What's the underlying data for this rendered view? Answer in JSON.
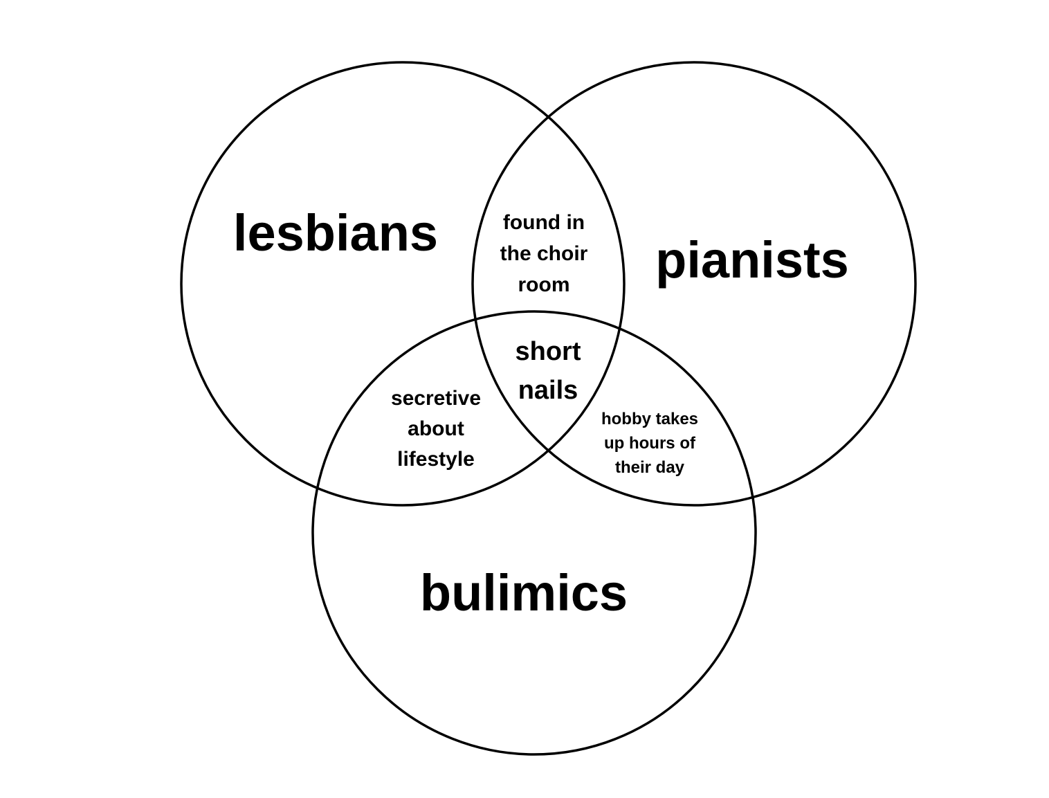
{
  "sets": [
    {
      "id": "left",
      "label": "lesbians"
    },
    {
      "id": "right",
      "label": "pianists"
    },
    {
      "id": "bottom",
      "label": "bulimics"
    }
  ],
  "intersections": {
    "left_right": [
      "found in",
      "the choir",
      "room"
    ],
    "left_bottom": [
      "secretive",
      "about",
      "lifestyle"
    ],
    "right_bottom": [
      "hobby takes",
      "up hours of",
      "their day"
    ],
    "all_three": [
      "short",
      "nails"
    ]
  },
  "colors": {
    "background": "#ffffff",
    "stroke": "#000000",
    "text": "#000000"
  }
}
